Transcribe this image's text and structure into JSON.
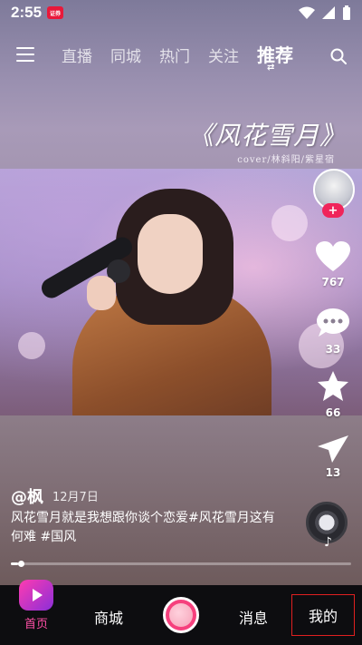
{
  "status_bar": {
    "time": "2:55",
    "app_badge_text": "证券"
  },
  "top_nav": {
    "tabs": [
      {
        "label": "直播"
      },
      {
        "label": "同城"
      },
      {
        "label": "热门"
      },
      {
        "label": "关注"
      },
      {
        "label": "推荐"
      }
    ],
    "active_tab_index": 4,
    "icons": [
      "menu-icon",
      "search-icon"
    ]
  },
  "video": {
    "song_title": "《风花雪月》",
    "song_credit": "cover/林斜阳/紫星宿"
  },
  "side_actions": {
    "follow_label": "+",
    "like_count": "767",
    "comment_count": "33",
    "favorite_count": "66",
    "share_count": "13"
  },
  "post": {
    "author": "@枫",
    "date": "12月7日",
    "caption": "风花雪月就是我想跟你谈个恋爱#风花雪月这有何难 #国风",
    "progress_fraction": 0.02
  },
  "bottom_nav": {
    "home_label": "首页",
    "mall_label": "商城",
    "messages_label": "消息",
    "me_label": "我的"
  },
  "colors": {
    "accent_pink": "#ff4fa7",
    "follow_red": "#f0245a",
    "highlight_box": "#e02020"
  }
}
